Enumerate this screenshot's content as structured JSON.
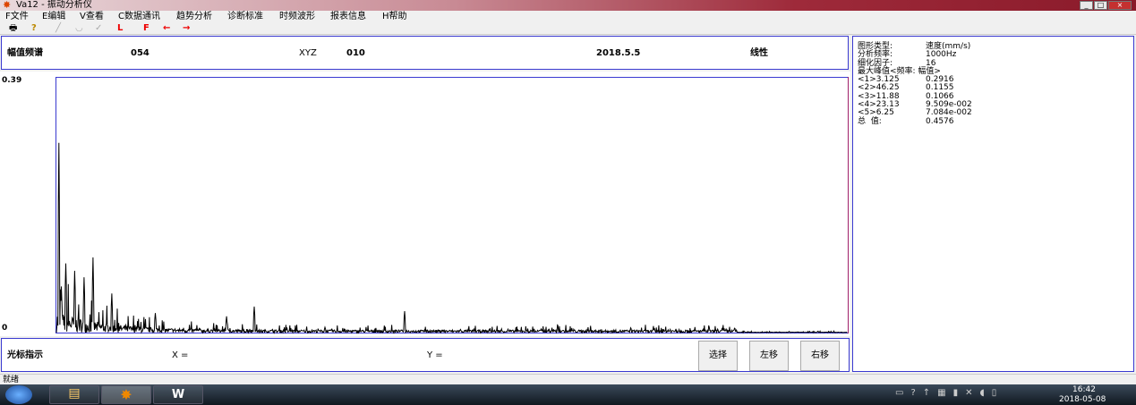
{
  "window": {
    "title": "Va12 - 振动分析仪",
    "controls": [
      "_",
      "□",
      "×"
    ]
  },
  "menu": [
    "F文件",
    "E编辑",
    "V查看",
    "C数据通讯",
    "趋势分析",
    "诊断标准",
    "时频波形",
    "报表信息",
    "H帮助"
  ],
  "toolbar": {
    "print": "print-icon",
    "help": "help-icon",
    "L": "L",
    "F": "F",
    "left": "←",
    "right": "→"
  },
  "header": {
    "title": "幅值频谱",
    "code": "054",
    "axis": "XYZ",
    "point": "010",
    "date": "2018.5.5",
    "scale": "线性"
  },
  "chart_data": {
    "type": "line",
    "xlim": [
      0,
      1000
    ],
    "ylim": [
      0,
      0.39
    ],
    "ytick_top": "0.39",
    "ytick_bottom": "0",
    "color": "#000000",
    "peaks": [
      [
        3.125,
        0.2916
      ],
      [
        46.25,
        0.1155
      ],
      [
        11.88,
        0.1066
      ],
      [
        23.13,
        0.09509
      ],
      [
        6.25,
        0.07084
      ],
      [
        35,
        0.085
      ],
      [
        70,
        0.06
      ],
      [
        125,
        0.03
      ],
      [
        215,
        0.025
      ],
      [
        250,
        0.04
      ],
      [
        440,
        0.033
      ]
    ]
  },
  "info": {
    "rows": [
      [
        "图形类型:",
        "速度(mm/s)"
      ],
      [
        "分析频率:",
        "1000Hz"
      ],
      [
        "细化因子:",
        "16"
      ],
      [
        "最大峰值<频率: 幅值>",
        ""
      ],
      [
        "<1>3.125",
        "0.2916"
      ],
      [
        "<2>46.25",
        "0.1155"
      ],
      [
        "<3>11.88",
        "0.1066"
      ],
      [
        "<4>23.13",
        "9.509e-002"
      ],
      [
        "<5>6.25",
        "7.084e-002"
      ],
      [
        "总  值:",
        "0.4576"
      ]
    ]
  },
  "cursor": {
    "title": "光标指示",
    "x": "X =",
    "y": "Y =",
    "select": "选择",
    "left": "左移",
    "right": "右移"
  },
  "status": "就绪",
  "clock": {
    "time": "16:42",
    "date": "2018-05-08"
  }
}
